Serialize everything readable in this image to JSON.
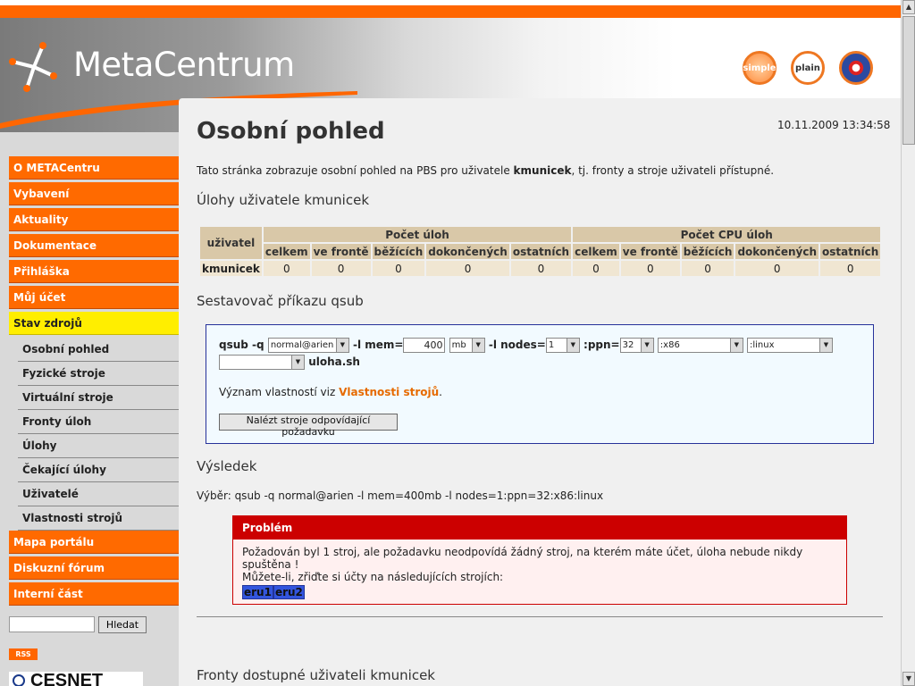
{
  "header": {
    "logo_text": "MetaCentrum",
    "buttons": [
      {
        "label": "simple",
        "icon": "simple-layout-icon"
      },
      {
        "label": "plain",
        "icon": "plain-layout-icon"
      },
      {
        "label": "",
        "icon": "english-flag-icon"
      }
    ]
  },
  "sidebar": {
    "items": [
      {
        "label": "O METACentru"
      },
      {
        "label": "Vybavení"
      },
      {
        "label": "Aktuality"
      },
      {
        "label": "Dokumentace"
      },
      {
        "label": "Přihláška"
      },
      {
        "label": "Můj účet"
      },
      {
        "label": "Stav zdrojů",
        "active": true
      }
    ],
    "subitems": [
      {
        "label": "Osobní pohled"
      },
      {
        "label": "Fyzické stroje"
      },
      {
        "label": "Virtuální stroje"
      },
      {
        "label": "Fronty úloh"
      },
      {
        "label": "Úlohy"
      },
      {
        "label": "Čekající úlohy"
      },
      {
        "label": "Uživatelé"
      },
      {
        "label": "Vlastnosti strojů"
      }
    ],
    "items_after": [
      {
        "label": "Mapa portálu"
      },
      {
        "label": "Diskuzní fórum"
      },
      {
        "label": "Interní část"
      }
    ],
    "search": {
      "value": "",
      "button_label": "Hledat"
    },
    "rss_label": "RSS",
    "cesnet_label": "CESNET"
  },
  "main": {
    "datetime": "10.11.2009 13:34:58",
    "title": "Osobní pohled",
    "intro_pre": "Tato stránka zobrazuje osobní pohled na PBS pro uživatele ",
    "intro_user": "kmunicek",
    "intro_post": ", tj. fronty a stroje uživateli přístupné.",
    "jobs_heading": "Úlohy uživatele kmunicek",
    "jobs_table": {
      "user_header": "uživatel",
      "group1": "Počet úloh",
      "group2": "Počet CPU úloh",
      "columns": [
        "celkem",
        "ve frontě",
        "běžících",
        "dokončených",
        "ostatních"
      ],
      "rows": [
        {
          "user": "kmunicek",
          "values": [
            "0",
            "0",
            "0",
            "0",
            "0",
            "0",
            "0",
            "0",
            "0",
            "0"
          ]
        }
      ]
    },
    "builder_heading": "Sestavovač příkazu qsub",
    "builder": {
      "qsub_label": "qsub -q",
      "queue": "normal@arien",
      "mem_label": "-l mem=",
      "mem_value": "400",
      "mem_unit": "mb",
      "nodes_label": "-l nodes=",
      "nodes_value": "1",
      "ppn_label": ":ppn=",
      "ppn_value": "32",
      "prop1": ":x86",
      "prop2": ":linux",
      "prop3": "",
      "script_label": "uloha.sh",
      "meaning_text": "Význam vlastností viz ",
      "meaning_link": "Vlastnosti strojů",
      "meaning_end": ".",
      "find_button": "Nalézt stroje odpovídající požadavku"
    },
    "result_heading": "Výsledek",
    "result_text": "Výběr: qsub -q normal@arien -l mem=400mb -l nodes=1:ppn=32:x86:linux",
    "problem": {
      "title": "Problém",
      "message": "Požadován byl 1 stroj, ale požadavku neodpovídá žádný stroj, na kterém máte účet, úloha nebude nikdy spuštěna !",
      "hint": "Můžete-li, zřiďte si účty na následujících strojích:",
      "machines": [
        "eru1",
        "eru2"
      ]
    },
    "queues_heading": "Fronty dostupné uživateli kmunicek"
  },
  "colors": {
    "accent": "#ff6600",
    "active": "#ffee00",
    "problem": "#cc0000",
    "link": "#e66a00"
  }
}
